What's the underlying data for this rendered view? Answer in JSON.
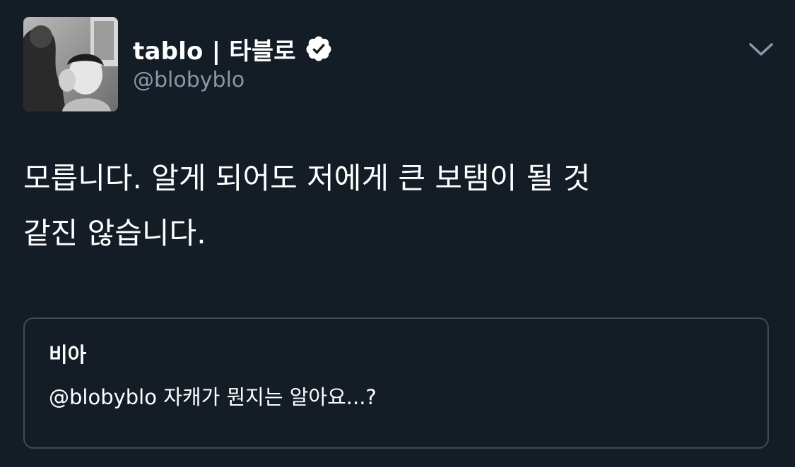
{
  "tweet": {
    "author": {
      "display_name": "tablo | 타블로",
      "handle": "@blobyblo",
      "verified": true,
      "verified_icon": "verified-badge-icon",
      "avatar": "profile-photo"
    },
    "menu_icon": "chevron-down-icon",
    "text": "모릅니다. 알게 되어도 저에게 큰 보탬이 될 것\n같진 않습니다.",
    "quoted": {
      "author": "비아",
      "text": "@blobyblo 자캐가 뭔지는 알아요...?"
    }
  },
  "colors": {
    "background": "#141d26",
    "text": "#ffffff",
    "secondary_text": "#8899a6",
    "quote_border": "#3d4b5a"
  }
}
